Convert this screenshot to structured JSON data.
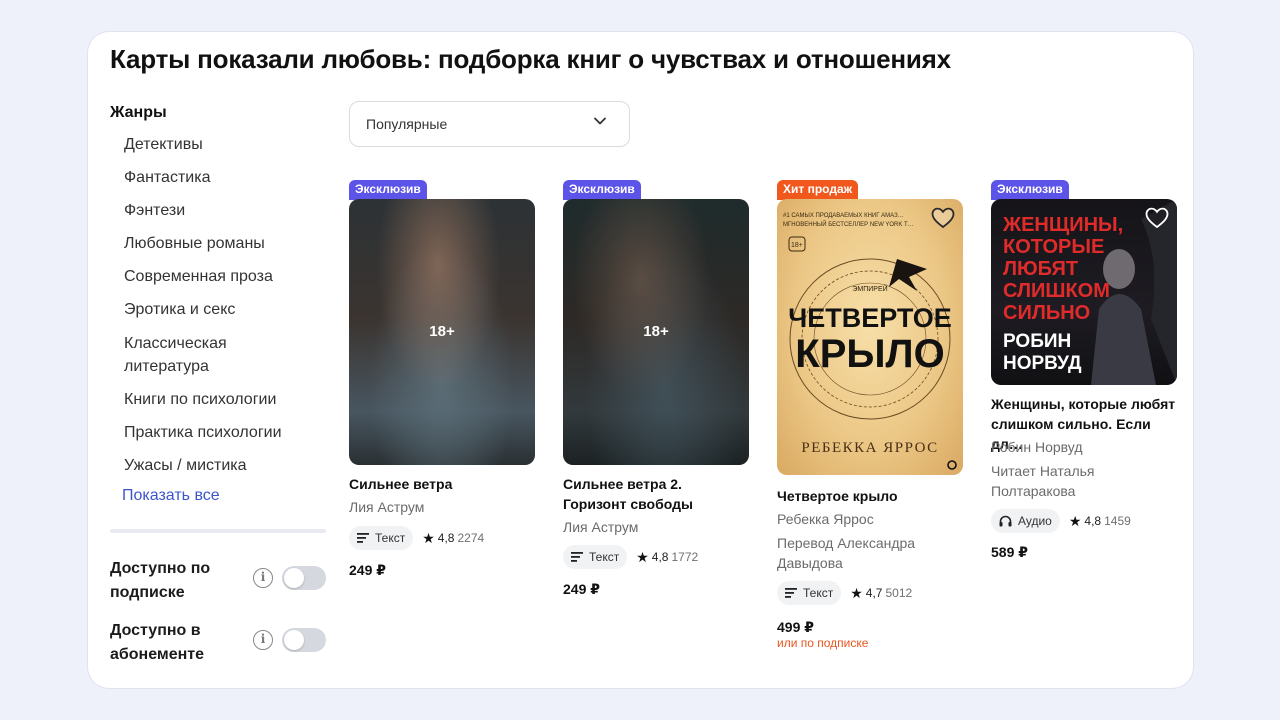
{
  "page": {
    "title": "Карты показали любовь: подборка книг о чувствах и отношениях"
  },
  "sidebar": {
    "heading": "Жанры",
    "genres": [
      "Детективы",
      "Фантастика",
      "Фэнтези",
      "Любовные романы",
      "Современная проза",
      "Эротика и секс",
      "Классическая литература",
      "Книги по психологии",
      "Практика психологии",
      "Ужасы / мистика"
    ],
    "show_all": "Показать все",
    "filters": [
      {
        "label": "Доступно по подписке",
        "enabled": false,
        "icon": "info-icon"
      },
      {
        "label": "Доступно в абонементе",
        "enabled": false,
        "icon": "info-icon"
      }
    ]
  },
  "sort": {
    "selected": "Популярные",
    "icon": "chevron-down-icon"
  },
  "books": [
    {
      "badge": "Эксклюзив",
      "cover_label": "18+",
      "title": "Сильнее ветра",
      "author": "Лия Аструм",
      "format": "Текст",
      "rating": "4,8",
      "reviews": "2274",
      "price": "249 ₽"
    },
    {
      "badge": "Эксклюзив",
      "cover_label": "18+",
      "title": "Сильнее ветра 2. Горизонт свободы",
      "author": "Лия Аструм",
      "format": "Текст",
      "rating": "4,8",
      "reviews": "1772",
      "price": "249 ₽"
    },
    {
      "badge": "Хит продаж",
      "title": "Четвертое крыло",
      "author": "Ребекка Яррос",
      "translator": "Перевод Александра Давыдова",
      "format": "Текст",
      "rating": "4,7",
      "reviews": "5012",
      "price": "499 ₽",
      "subscription_note": "или по подписке",
      "cover_texts": {
        "top": "#1 САМЫХ ПРОДАВАЕМЫХ КНИГ АМАЗ…",
        "top2": "МГНОВЕННЫЙ БЕСТСЕЛЛЕР NEW YORK T…",
        "age": "18+",
        "series": "ЭМПИРЕЙ",
        "title_line1": "ЧЕТВЕРТОЕ",
        "title_line2": "КРЫЛО",
        "author": "РЕБЕККА ЯРРОС"
      }
    },
    {
      "badge": "Эксклюзив",
      "title": "Женщины, которые любят слишком сильно. Если дл…",
      "author": "Робин Норвуд",
      "narrator": "Читает Наталья Полтаракова",
      "format": "Аудио",
      "rating": "4,8",
      "reviews": "1459",
      "price": "589 ₽",
      "cover_texts": {
        "title_lines": [
          "ЖЕНЩИНЫ,",
          "КОТОРЫЕ",
          "ЛЮБЯТ",
          "СЛИШКОМ",
          "СИЛЬНО"
        ],
        "author_lines": [
          "РОБИН",
          "НОРВУД"
        ]
      }
    }
  ],
  "colors": {
    "background": "#eef1f9",
    "link": "#3c56c8",
    "badge_exclusive": "#5c53e8",
    "badge_hit": "#f0581e",
    "subscription_note": "#e8551f"
  }
}
